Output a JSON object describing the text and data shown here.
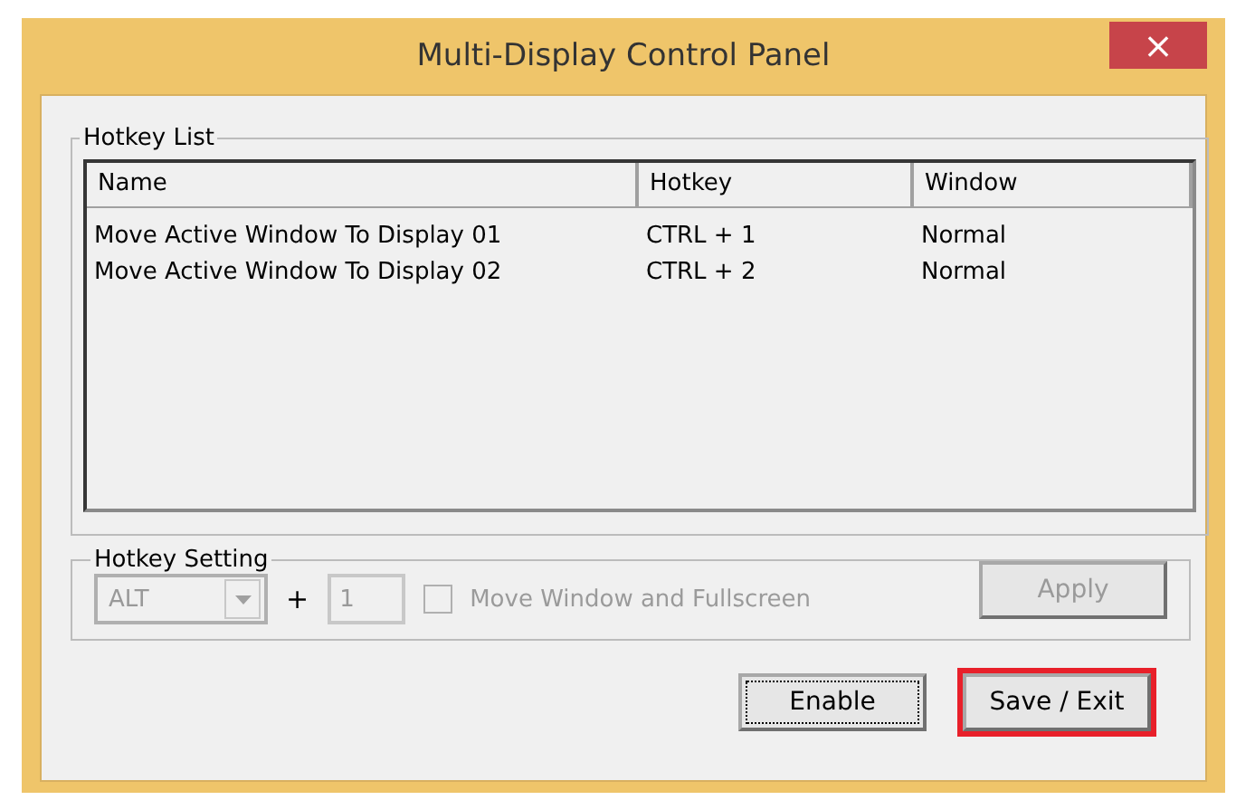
{
  "window": {
    "title": "Multi-Display Control Panel",
    "close": "×"
  },
  "hotkey_list": {
    "label": "Hotkey List",
    "columns": [
      "Name",
      "Hotkey",
      "Window"
    ],
    "rows": [
      {
        "cells": [
          "Move Active Window To Display 01",
          "CTRL + 1",
          "Normal"
        ],
        "selected": false
      },
      {
        "cells": [
          "Move Active Window To Display 02",
          "CTRL + 2",
          "Normal"
        ],
        "selected": false
      }
    ]
  },
  "hotkey_setting": {
    "label": "Hotkey Setting",
    "modifier": {
      "value": "ALT",
      "disabled": true
    },
    "plus": "+",
    "key": {
      "value": "1",
      "disabled": true
    },
    "fullscreen": {
      "label": "Move Window and Fullscreen",
      "checked": false,
      "disabled": true
    },
    "apply": {
      "label": "Apply",
      "disabled": true
    }
  },
  "buttons": [
    {
      "label": "Enable",
      "focused": true,
      "highlighted": false
    },
    {
      "label": "Save / Exit",
      "focused": false,
      "highlighted": true
    }
  ]
}
